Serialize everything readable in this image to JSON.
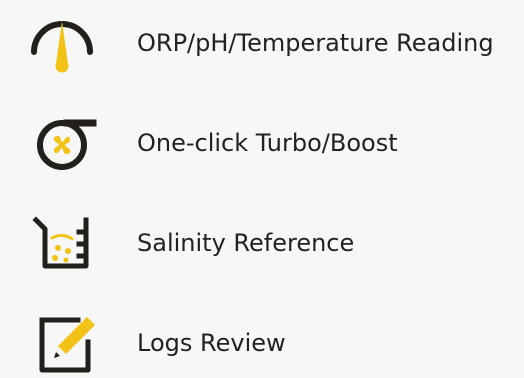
{
  "colors": {
    "background": "#f7f7f7",
    "icon_dark": "#231f1b",
    "accent_yellow": "#f2c316",
    "text": "#222222"
  },
  "features": [
    {
      "label": "ORP/pH/Temperature Reading",
      "icon": "gauge-icon"
    },
    {
      "label": "One-click Turbo/Boost",
      "icon": "turbo-fan-icon"
    },
    {
      "label": "Salinity Reference",
      "icon": "beaker-icon"
    },
    {
      "label": "Logs Review",
      "icon": "pencil-notepad-icon"
    }
  ]
}
